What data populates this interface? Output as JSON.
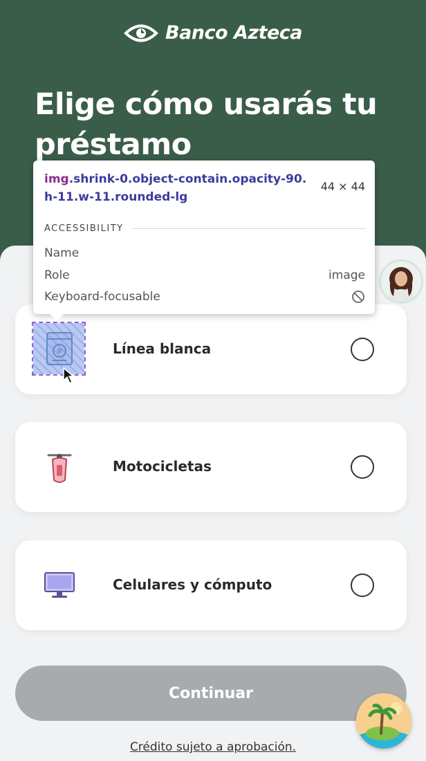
{
  "brand": {
    "name": "Banco Azteca"
  },
  "page": {
    "headline": "Elige cómo usarás tu préstamo"
  },
  "options": [
    {
      "label": "Línea blanca",
      "icon": "appliance-icon",
      "selected": false
    },
    {
      "label": "Motocicletas",
      "icon": "motorcycle-icon",
      "selected": false
    },
    {
      "label": "Celulares y cómputo",
      "icon": "computer-monitor-icon",
      "selected": false
    }
  ],
  "actions": {
    "continue_label": "Continuar",
    "continue_enabled": false
  },
  "footer": {
    "disclaimer": "Crédito sujeto a aprobación."
  },
  "inspector": {
    "selector_tag": "img",
    "selector_rest": ".shrink-0.object-contain.opacity-90.h-11.w-11.rounded-lg",
    "size": "44 × 44",
    "section_title": "ACCESSIBILITY",
    "rows": [
      {
        "label": "Name",
        "value": ""
      },
      {
        "label": "Role",
        "value": "image"
      },
      {
        "label": "Keyboard-focusable",
        "value": ""
      }
    ]
  },
  "colors": {
    "header_bg": "#3a5d49",
    "page_bg": "#f1f2f3",
    "button_disabled": "#a8abad",
    "selector_tag": "#8a2c8c",
    "selector_class": "#3e3a9c"
  }
}
